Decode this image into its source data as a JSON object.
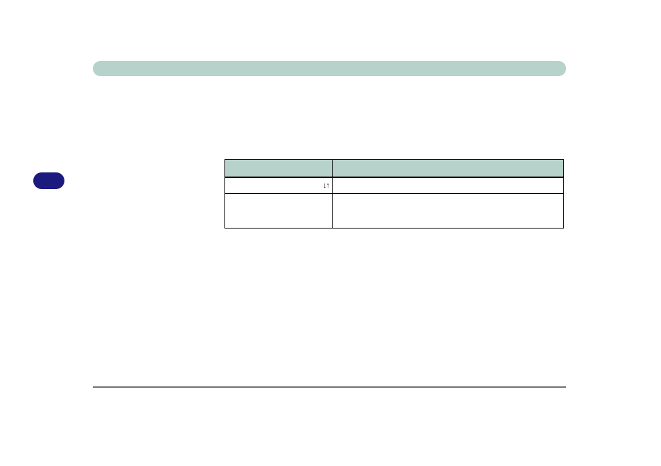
{
  "title_bar": {
    "label": ""
  },
  "left_pill": {
    "label": ""
  },
  "table": {
    "header": {
      "col1": "",
      "col2": ""
    },
    "rows": [
      {
        "col1_arrows": "↓↑",
        "col2": ""
      },
      {
        "col1": "",
        "col2": ""
      }
    ]
  }
}
